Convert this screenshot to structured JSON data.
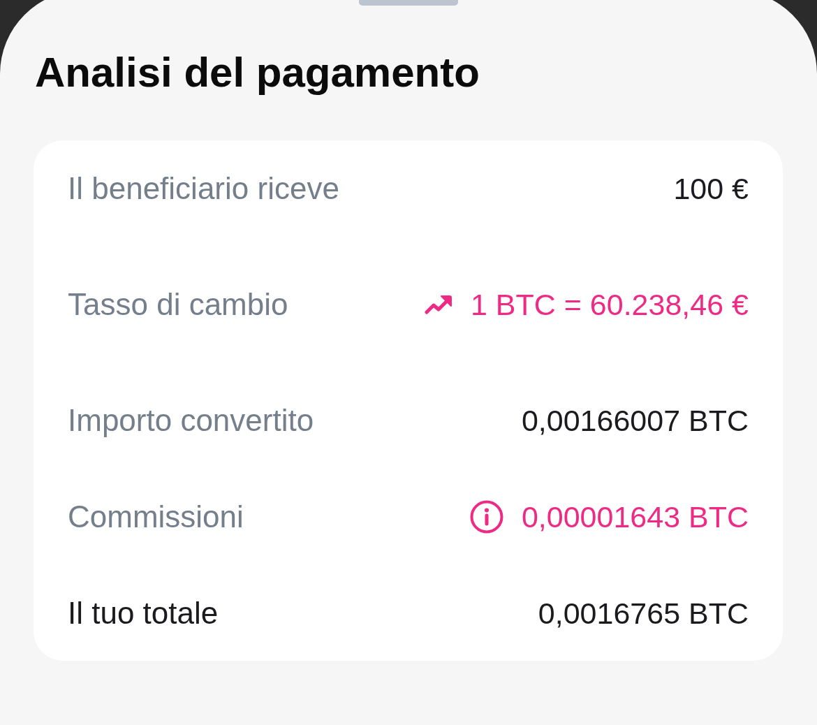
{
  "sheet": {
    "title": "Analisi del pagamento"
  },
  "breakdown": {
    "rows": [
      {
        "kind": "plain",
        "label": "Il beneficiario riceve",
        "value": "100 €"
      },
      {
        "kind": "rate",
        "label": "Tasso di cambio",
        "value": "1 BTC = 60.238,46 €"
      },
      {
        "kind": "plain",
        "label": "Importo convertito",
        "value": "0,00166007 BTC"
      },
      {
        "kind": "fee",
        "label": "Commissioni",
        "value": "0,00001643 BTC"
      },
      {
        "kind": "total",
        "label": "Il tuo totale",
        "value": "0,0016765 BTC"
      }
    ]
  }
}
